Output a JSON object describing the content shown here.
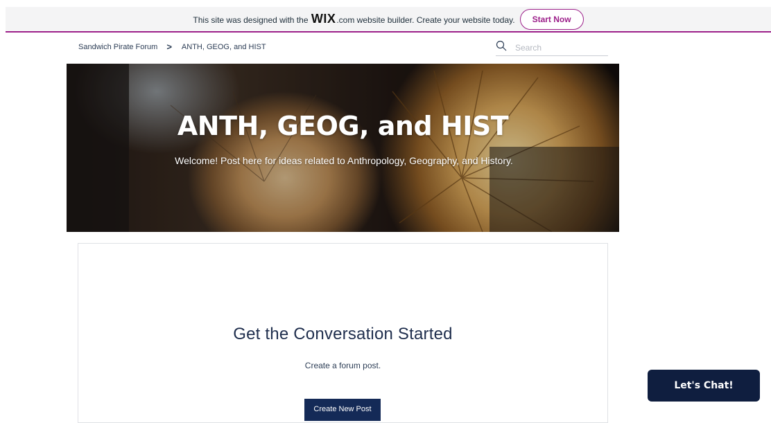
{
  "banner": {
    "text_before": "This site was designed with the",
    "logo": "WIX",
    "text_after": ".com website builder. Create your website today.",
    "cta_label": "Start Now",
    "accent_color": "#9c1f8a"
  },
  "breadcrumb": {
    "items": [
      "Sandwich Pirate Forum",
      "ANTH, GEOG, and HIST"
    ],
    "separator": ">"
  },
  "search": {
    "placeholder": "Search",
    "icon": "search-icon"
  },
  "hero": {
    "title": "ANTH, GEOG, and HIST",
    "subtitle": "Welcome! Post here for ideas related to Anthropology, Geography, and History."
  },
  "empty_state": {
    "title": "Get the Conversation Started",
    "subtitle": "Create a forum post.",
    "button_label": "Create New Post",
    "button_color": "#142a57"
  },
  "chat": {
    "label": "Let's Chat!",
    "color": "#0f1e3f"
  }
}
